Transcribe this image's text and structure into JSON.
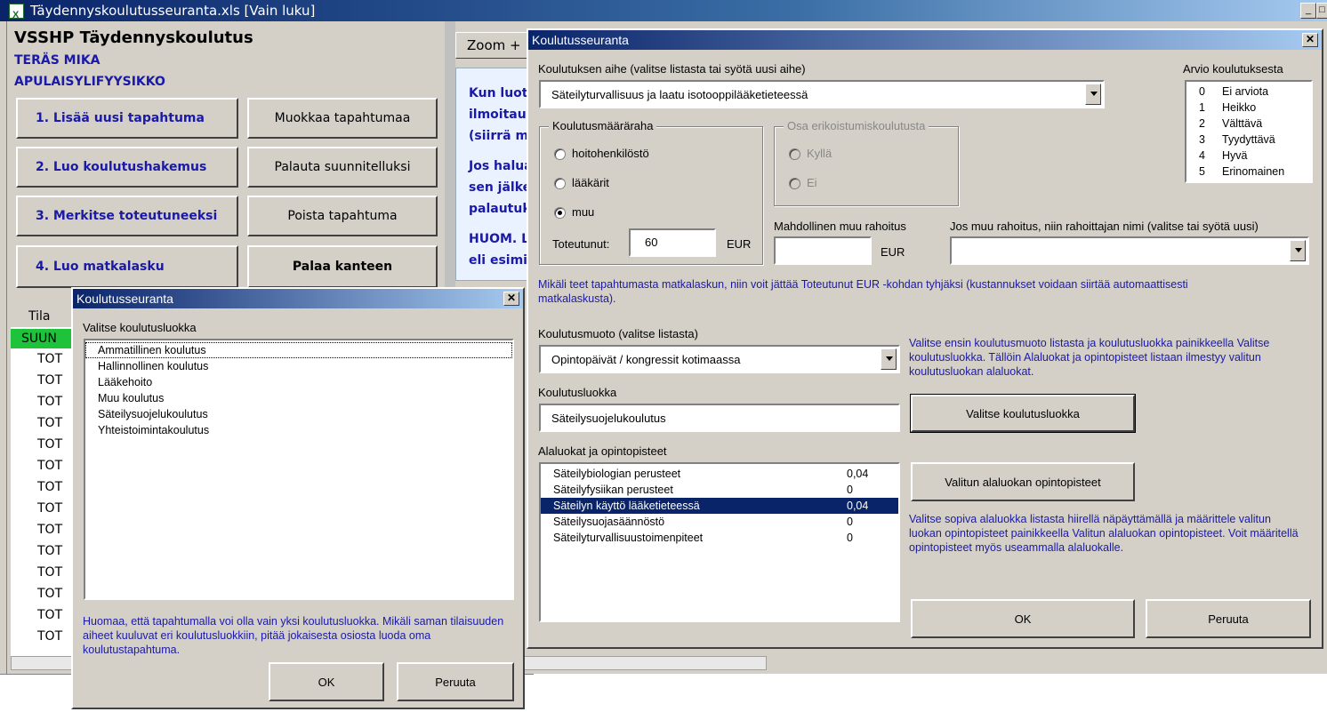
{
  "excel": {
    "title": "Täydennyskoulutusseuranta.xls  [Vain luku]",
    "header_title": "VSSHP Täydennyskoulutus",
    "user_name": "TERÄS MIKA",
    "user_title": "APULAISYLIFYYSIKKO",
    "zoom_label": "Zoom +",
    "buttons": [
      {
        "label": "1. Lisää uusi tapahtuma"
      },
      {
        "label": "Muokkaa tapahtumaa"
      },
      {
        "label": "2. Luo koulutushakemus"
      },
      {
        "label": "Palauta suunnitelluksi"
      },
      {
        "label": "3. Merkitse toteutuneeksi"
      },
      {
        "label": "Poista tapahtuma"
      },
      {
        "label": "4. Luo matkalasku"
      },
      {
        "label": "Palaa kanteen"
      }
    ],
    "info_lines": [
      "Kun luot",
      "ilmoitau",
      "(siirrä my",
      "Jos halua",
      "sen jälke",
      "palautuk",
      "HUOM. L",
      "eli esimie"
    ],
    "tila_header": "Tila",
    "tila_first": "SUUN",
    "tila_rows": [
      "TOT",
      "TOT",
      "TOT",
      "TOT",
      "TOT",
      "TOT",
      "TOT",
      "TOT",
      "TOT",
      "TOT",
      "TOT",
      "TOT",
      "TOT",
      "TOT"
    ]
  },
  "dlg_class": {
    "title": "Koulutusseuranta",
    "close": "✕",
    "list_label": "Valitse koulutusluokka",
    "items": [
      "Ammatillinen koulutus",
      "Hallinnollinen koulutus",
      "Lääkehoito",
      "Muu koulutus",
      "Säteilysuojelukoulutus",
      "Yhteistoimintakoulutus"
    ],
    "note": "Huomaa, että tapahtumalla voi olla vain yksi koulutusluokka. Mikäli saman tilaisuuden aiheet kuuluvat eri koulutusluokkiin, pitää jokaisesta osiosta luoda oma koulutustapahtuma.",
    "ok": "OK",
    "cancel": "Peruuta"
  },
  "dlg_main": {
    "title": "Koulutusseuranta",
    "close": "✕",
    "topic_label": "Koulutuksen aihe (valitse listasta tai syötä uusi aihe)",
    "topic_value": "Säteilyturvallisuus ja laatu isotooppilääketieteessä",
    "rating_label": "Arvio koulutuksesta",
    "ratings": [
      {
        "num": "0",
        "text": "Ei arviota"
      },
      {
        "num": "1",
        "text": "Heikko"
      },
      {
        "num": "2",
        "text": "Välttävä"
      },
      {
        "num": "3",
        "text": "Tyydyttävä"
      },
      {
        "num": "4",
        "text": "Hyvä"
      },
      {
        "num": "5",
        "text": "Erinomainen"
      }
    ],
    "funding_group": "Koulutusmääräraha",
    "funding_options": [
      "hoitohenkilöstö",
      "lääkärit",
      "muu"
    ],
    "funding_selected": "muu",
    "actual_label": "Toteutunut:",
    "actual_value": "60",
    "currency": "EUR",
    "specialist_group": "Osa erikoistumiskoulutusta",
    "specialist_options": [
      "Kyllä",
      "Ei"
    ],
    "other_funding_label": "Mahdollinen muu rahoitus",
    "other_funding_value": "",
    "funder_label": "Jos muu rahoitus, niin rahoittajan nimi (valitse tai syötä uusi)",
    "funder_value": "",
    "travel_note": "Mikäli teet tapahtumasta matkalaskun, niin voit jättää Toteutunut EUR -kohdan tyhjäksi (kustannukset voidaan siirtää automaattisesti matkalaskusta).",
    "form_label": "Koulutusmuoto (valitse listasta)",
    "form_value": "Opintopäivät / kongressit kotimaassa",
    "form_note": "Valitse ensin koulutusmuoto listasta ja koulutusluokka painikkeella Valitse koulutusluokka. Tällöin Alaluokat ja opintopisteet listaan ilmestyy valitun koulutusluokan alaluokat.",
    "class_label": "Koulutusluokka",
    "class_value": "Säteilysuojelukoulutus",
    "choose_class_btn": "Valitse koulutusluokka",
    "subclass_label": "Alaluokat ja opintopisteet",
    "subclasses": [
      {
        "name": "Säteilybiologian perusteet",
        "points": "0,04"
      },
      {
        "name": "Säteilyfysiikan perusteet",
        "points": "0"
      },
      {
        "name": "Säteilyn käyttö lääketieteessä",
        "points": "0,04"
      },
      {
        "name": "Säteilysuojasäännöstö",
        "points": "0"
      },
      {
        "name": "Säteilyturvallisuustoimenpiteet",
        "points": "0"
      }
    ],
    "selected_subclass": "Säteilyn käyttö lääketieteessä",
    "points_btn": "Valitun alaluokan opintopisteet",
    "points_note": "Valitse sopiva alaluokka listasta hiirellä näpäyttämällä ja määrittele valitun luokan opintopisteet painikkeella Valitun alaluokan opintopisteet. Voit määritellä opintopisteet myös useammalla alaluokalle.",
    "ok": "OK",
    "cancel": "Peruuta"
  }
}
